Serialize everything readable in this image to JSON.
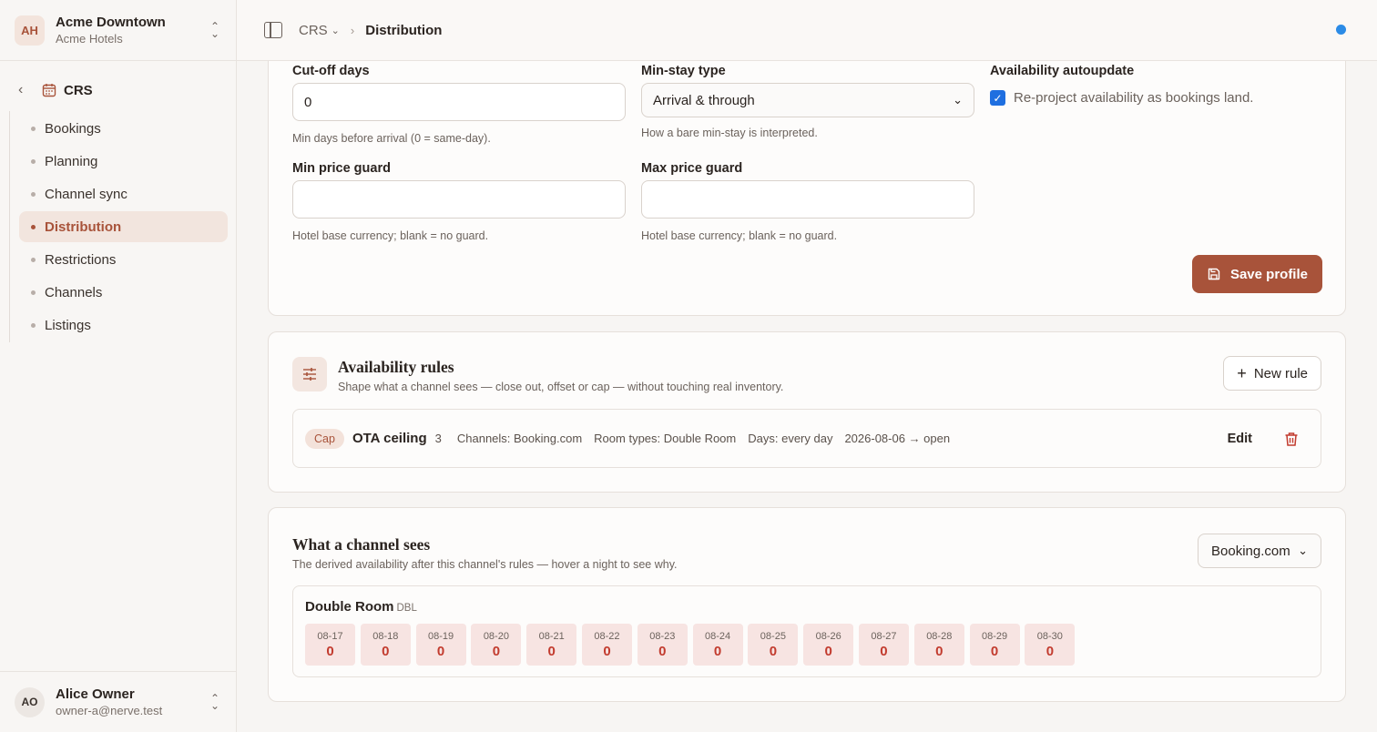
{
  "org": {
    "initials": "AH",
    "name": "Acme Downtown",
    "subtitle": "Acme Hotels"
  },
  "nav": {
    "section": "CRS",
    "items": [
      {
        "label": "Bookings"
      },
      {
        "label": "Planning"
      },
      {
        "label": "Channel sync"
      },
      {
        "label": "Distribution",
        "active": true
      },
      {
        "label": "Restrictions"
      },
      {
        "label": "Channels"
      },
      {
        "label": "Listings"
      }
    ]
  },
  "user": {
    "initials": "AO",
    "name": "Alice Owner",
    "email": "owner-a@nerve.test"
  },
  "breadcrumb": {
    "root": "CRS",
    "current": "Distribution"
  },
  "profile": {
    "cutoff": {
      "label": "Cut-off days",
      "value": "0",
      "hint": "Min days before arrival (0 = same-day)."
    },
    "minstay": {
      "label": "Min-stay type",
      "value": "Arrival & through",
      "hint": "How a bare min-stay is interpreted."
    },
    "autoupdate": {
      "label": "Availability autoupdate",
      "checkbox_label": "Re-project availability as bookings land.",
      "checked": true
    },
    "minprice": {
      "label": "Min price guard",
      "value": "",
      "hint": "Hotel base currency; blank = no guard."
    },
    "maxprice": {
      "label": "Max price guard",
      "value": "",
      "hint": "Hotel base currency; blank = no guard."
    },
    "save_label": "Save profile"
  },
  "rules": {
    "title": "Availability rules",
    "subtitle": "Shape what a channel sees — close out, offset or cap — without touching real inventory.",
    "new_label": "New rule",
    "items": [
      {
        "type": "Cap",
        "name": "OTA ceiling",
        "value": "3",
        "channels": "Channels: Booking.com",
        "room_types": "Room types: Double Room",
        "days": "Days: every day",
        "range": "2026-08-06 → open",
        "edit_label": "Edit"
      }
    ]
  },
  "channel_view": {
    "title": "What a channel sees",
    "subtitle": "The derived availability after this channel's rules — hover a night to see why.",
    "selected_channel": "Booking.com",
    "room": {
      "name": "Double Room",
      "code": "DBL"
    },
    "nights": [
      {
        "date": "08-17",
        "value": "0"
      },
      {
        "date": "08-18",
        "value": "0"
      },
      {
        "date": "08-19",
        "value": "0"
      },
      {
        "date": "08-20",
        "value": "0"
      },
      {
        "date": "08-21",
        "value": "0"
      },
      {
        "date": "08-22",
        "value": "0"
      },
      {
        "date": "08-23",
        "value": "0"
      },
      {
        "date": "08-24",
        "value": "0"
      },
      {
        "date": "08-25",
        "value": "0"
      },
      {
        "date": "08-26",
        "value": "0"
      },
      {
        "date": "08-27",
        "value": "0"
      },
      {
        "date": "08-28",
        "value": "0"
      },
      {
        "date": "08-29",
        "value": "0"
      },
      {
        "date": "08-30",
        "value": "0"
      }
    ]
  },
  "colors": {
    "accent": "#a8533a",
    "status_dot": "#2b8be6",
    "zero_avail": "#c23b2e"
  }
}
